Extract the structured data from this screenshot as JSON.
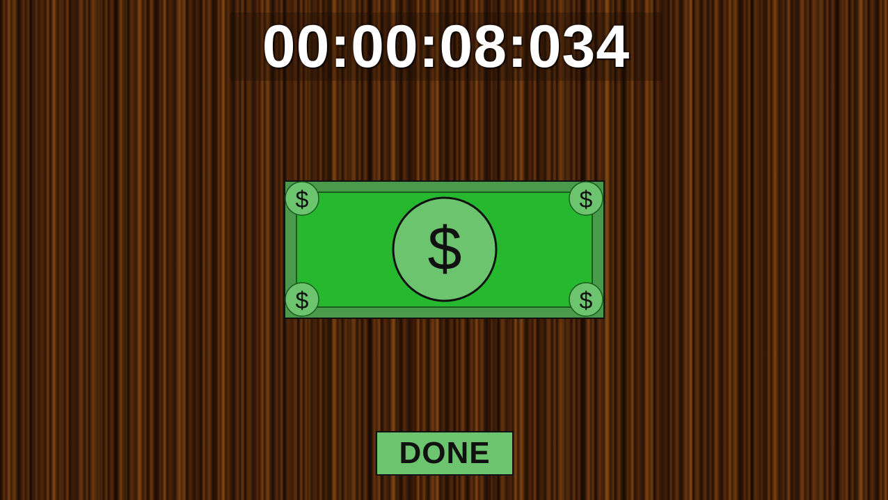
{
  "timer": {
    "display": "00:00:08:034"
  },
  "bill": {
    "icon": "dollar-bill-icon",
    "center_symbol": "$",
    "corner_symbol": "$",
    "colors": {
      "body": "#26b82e",
      "frame": "#4a9a4c",
      "medallion": "#6cc46f",
      "outline": "#111111"
    }
  },
  "done_button": {
    "label": "DONE",
    "color": "#6cc46f"
  }
}
